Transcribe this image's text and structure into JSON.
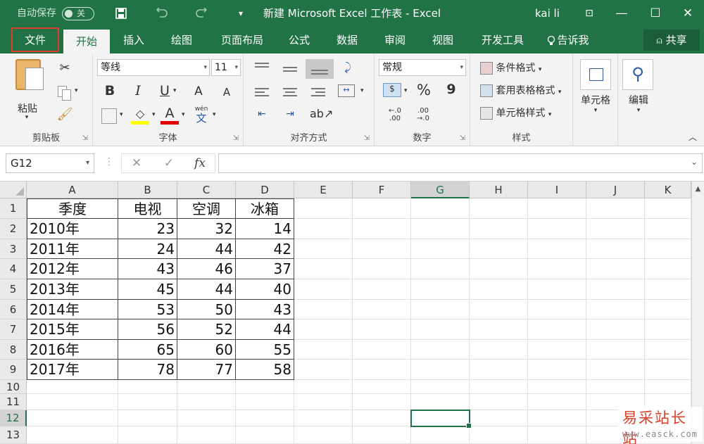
{
  "titlebar": {
    "autosave_label": "自动保存",
    "autosave_state": "关",
    "save_icon": "save-icon",
    "undo_icon": "undo-icon",
    "redo_icon": "redo-icon",
    "title": "新建 Microsoft Excel 工作表  -  Excel",
    "user": "kai li",
    "buttons": {
      "ribbon_options": "⊡",
      "minimize": "—",
      "maximize": "☐",
      "close": "✕"
    }
  },
  "tabs": [
    "文件",
    "开始",
    "插入",
    "绘图",
    "页面布局",
    "公式",
    "数据",
    "审阅",
    "视图",
    "开发工具",
    "告诉我"
  ],
  "share_label": "共享",
  "ribbon": {
    "clipboard": {
      "paste": "粘贴",
      "label": "剪贴板"
    },
    "font": {
      "name": "等线",
      "size": "11",
      "bold": "B",
      "italic": "I",
      "underline": "U",
      "grow": "A",
      "shrink": "A",
      "fontcolor": "A",
      "phonetic": "wén",
      "phonetic_char": "文",
      "label": "字体"
    },
    "alignment": {
      "label": "对齐方式"
    },
    "number": {
      "format": "常规",
      "percent": "%",
      "comma": "9",
      "inc_decimal_top": "←.0",
      "inc_decimal_bottom": ".00",
      "dec_decimal_top": ".00",
      "dec_decimal_bottom": "→.0",
      "label": "数字"
    },
    "styles": {
      "conditional": "条件格式",
      "table": "套用表格格式",
      "cell": "单元格样式",
      "label": "样式"
    },
    "cells": {
      "label": "单元格"
    },
    "editing": {
      "label": "编辑"
    }
  },
  "formula_bar": {
    "name_box": "G12",
    "cancel": "✕",
    "enter": "✓",
    "fx": "fx",
    "value": ""
  },
  "columns": [
    "A",
    "B",
    "C",
    "D",
    "E",
    "F",
    "G",
    "H",
    "I",
    "J",
    "K"
  ],
  "rows": [
    "1",
    "2",
    "3",
    "4",
    "5",
    "6",
    "7",
    "8",
    "9",
    "10",
    "11",
    "12",
    "13"
  ],
  "table": {
    "header": [
      "季度",
      "电视",
      "空调",
      "冰箱"
    ],
    "rows": [
      [
        "2010年",
        "23",
        "32",
        "14"
      ],
      [
        "2011年",
        "24",
        "44",
        "42"
      ],
      [
        "2012年",
        "43",
        "46",
        "37"
      ],
      [
        "2013年",
        "45",
        "44",
        "40"
      ],
      [
        "2014年",
        "53",
        "50",
        "43"
      ],
      [
        "2015年",
        "56",
        "52",
        "44"
      ],
      [
        "2016年",
        "65",
        "60",
        "55"
      ],
      [
        "2017年",
        "78",
        "77",
        "58"
      ]
    ]
  },
  "selected_cell": "G12",
  "watermark": {
    "line1": "易采站长站",
    "line2": "www.easck.com"
  },
  "colors": {
    "brand": "#217346",
    "file_highlight": "#e23b2f"
  }
}
